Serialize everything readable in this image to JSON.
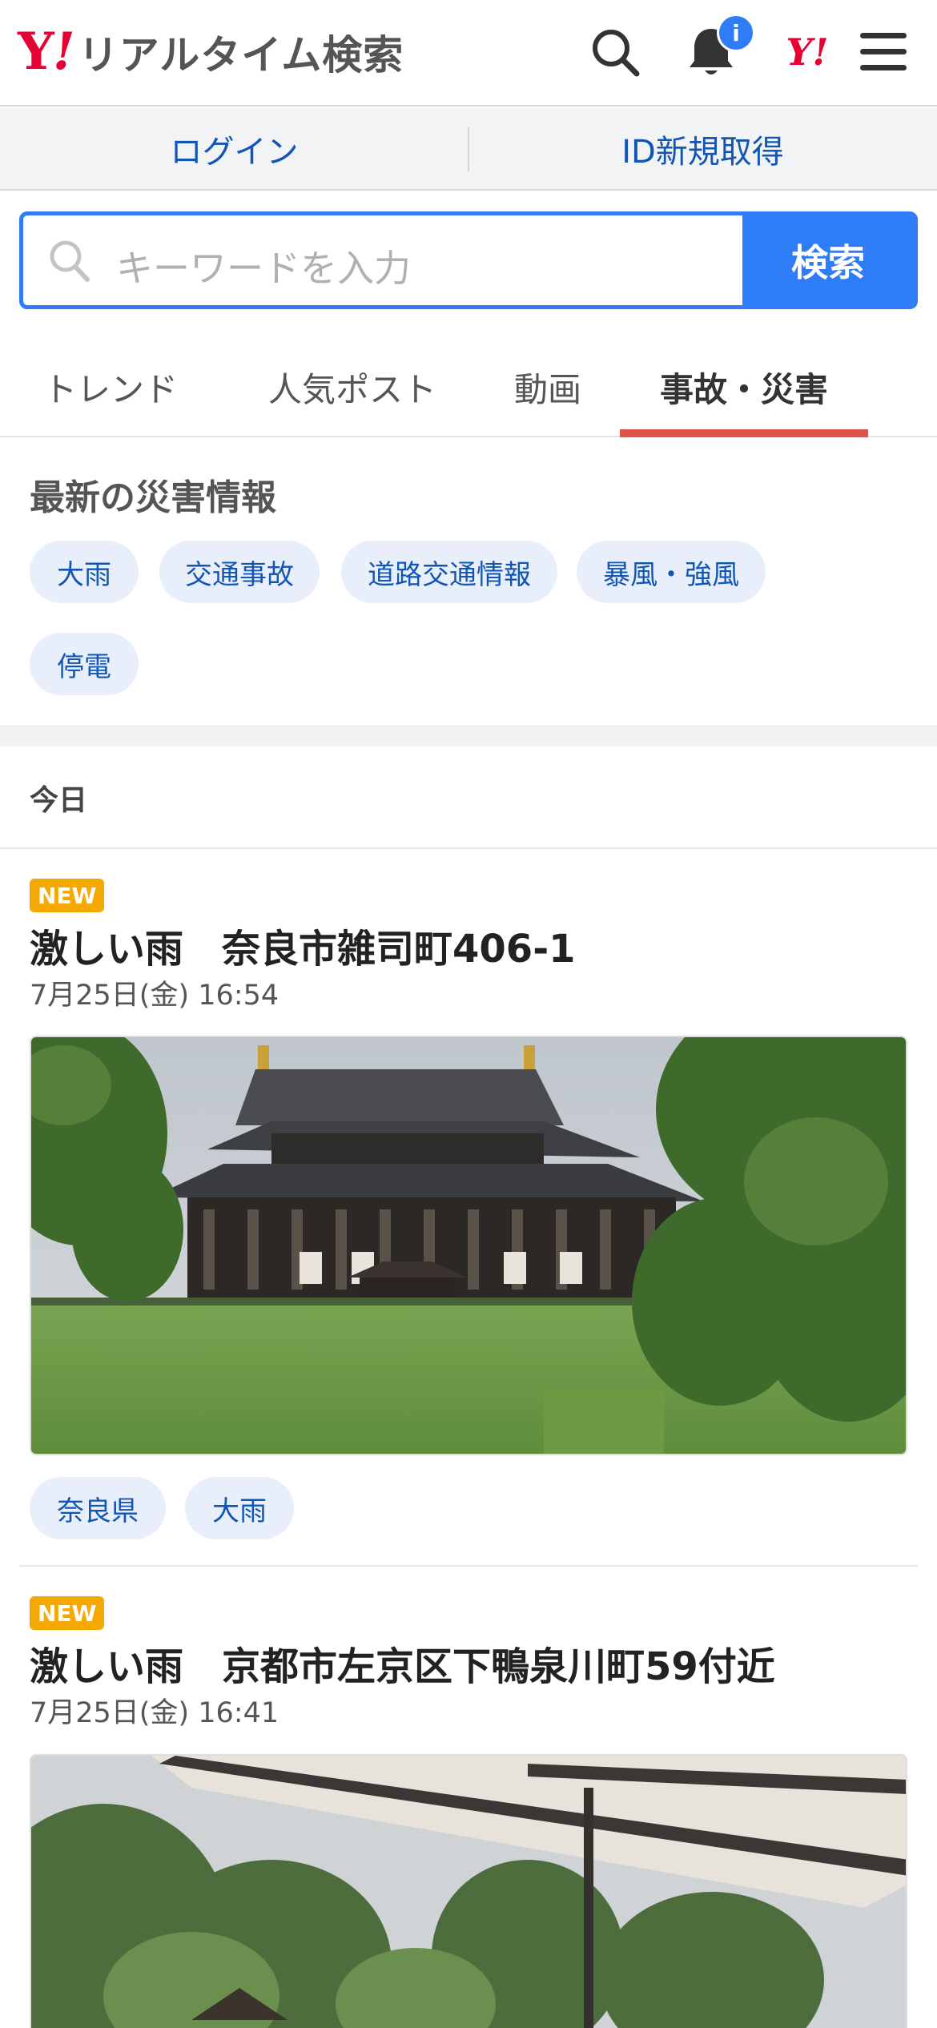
{
  "header": {
    "logo_y": "Y",
    "logo_bang": "!",
    "logo_text": "リアルタイム検索",
    "notification_badge": "i",
    "yahoo_mark": "Y!",
    "icons": [
      "search-icon",
      "bell-icon",
      "yahoo-japan-icon",
      "menu-icon"
    ]
  },
  "login_bar": {
    "login": "ログイン",
    "signup": "ID新規取得"
  },
  "search": {
    "placeholder": "キーワードを入力",
    "button": "検索",
    "accent": "#2e7cf6"
  },
  "tabs": [
    {
      "label": "トレンド",
      "active": false
    },
    {
      "label": "人気ポスト",
      "active": false
    },
    {
      "label": "動画",
      "active": false
    },
    {
      "label": "事故・災害",
      "active": true
    }
  ],
  "disaster": {
    "title": "最新の災害情報",
    "chips": [
      "大雨",
      "交通事故",
      "道路交通情報",
      "暴風・強風",
      "停電"
    ]
  },
  "date_section": "今日",
  "posts": [
    {
      "badge": "NEW",
      "title": "激しい雨　奈良市雑司町406-1",
      "date": "7月25日(金) 16:54",
      "tags": [
        "奈良県",
        "大雨"
      ]
    },
    {
      "badge": "NEW",
      "title": "激しい雨　京都市左京区下鴨泉川町59付近",
      "date": "7月25日(金) 16:41"
    }
  ],
  "colors": {
    "brand_red": "#e60033",
    "tab_active_underline": "#e0534a",
    "new_badge": "#f4a800",
    "link_blue": "#1155b5"
  }
}
